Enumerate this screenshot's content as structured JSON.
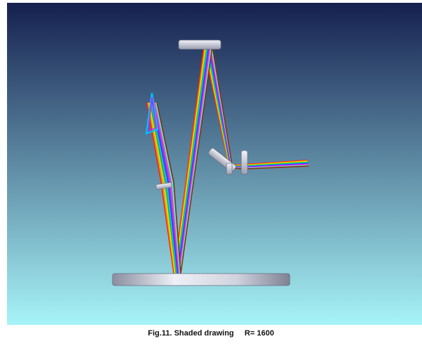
{
  "figure": {
    "caption": "Fig.11. Shaded drawing     R= 1600"
  },
  "scene": {
    "background_top_color": "#15204f",
    "background_bottom_color": "#a7f4f8",
    "component_color": "#d8dce6",
    "ray_colors": [
      "#ff2020",
      "#ff9900",
      "#e6e600",
      "#20c020",
      "#00c0ff",
      "#2040ff",
      "#c020ff",
      "#ff40c0",
      "#40ffd0",
      "#8a3010"
    ]
  }
}
